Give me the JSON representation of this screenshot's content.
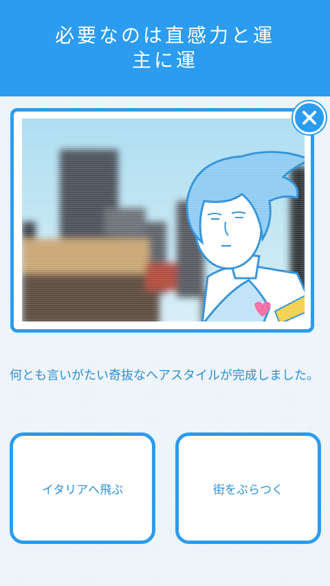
{
  "header": {
    "title_line1": "必要なのは直感力と運",
    "title_line2": "主に運"
  },
  "scene": {
    "description_icons": [
      "building-photo",
      "blue-haired-character",
      "heart"
    ]
  },
  "close_icon": "close-icon",
  "message": {
    "text": "何とも言いがたい奇抜なヘアスタイルが完成しました。"
  },
  "choices": [
    {
      "label": "イタリアへ飛ぶ"
    },
    {
      "label": "街をぶらつく"
    }
  ],
  "colors": {
    "accent": "#2b9cef",
    "text_blue": "#2b8fd8",
    "background": "#eef5fb"
  }
}
